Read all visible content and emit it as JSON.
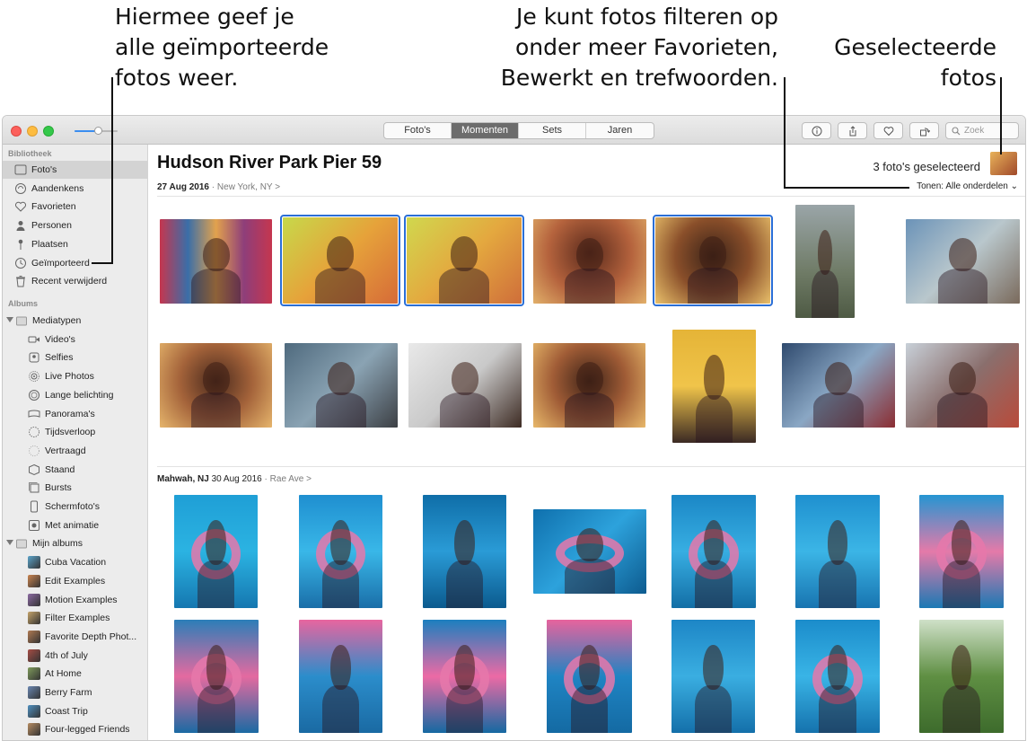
{
  "callouts": {
    "left": [
      "Hiermee geef je",
      "alle geïmporteerde",
      "fotos weer."
    ],
    "middle": [
      "Je kunt fotos filteren op",
      "onder meer Favorieten,",
      "Bewerkt en trefwoorden."
    ],
    "right": [
      "Geselecteerde",
      "fotos"
    ]
  },
  "toolbar": {
    "segments": [
      "Foto's",
      "Momenten",
      "Sets",
      "Jaren"
    ],
    "active_segment": "Momenten",
    "buttons": [
      "info-icon",
      "share-icon",
      "heart-icon",
      "rotate-icon"
    ],
    "search_placeholder": "Zoek"
  },
  "sidebar": {
    "library_header": "Bibliotheek",
    "library": [
      {
        "label": "Foto's",
        "icon": "photos-icon",
        "selected": true
      },
      {
        "label": "Aandenkens",
        "icon": "memories-icon"
      },
      {
        "label": "Favorieten",
        "icon": "heart-icon"
      },
      {
        "label": "Personen",
        "icon": "person-icon"
      },
      {
        "label": "Plaatsen",
        "icon": "pin-icon"
      },
      {
        "label": "Geïmporteerd",
        "icon": "clock-icon"
      },
      {
        "label": "Recent verwijderd",
        "icon": "trash-icon"
      }
    ],
    "albums_header": "Albums",
    "media_types_label": "Mediatypen",
    "media_types": [
      {
        "label": "Video's",
        "icon": "video-icon"
      },
      {
        "label": "Selfies",
        "icon": "selfie-icon"
      },
      {
        "label": "Live Photos",
        "icon": "live-icon"
      },
      {
        "label": "Lange belichting",
        "icon": "long-exposure-icon"
      },
      {
        "label": "Panorama's",
        "icon": "panorama-icon"
      },
      {
        "label": "Tijdsverloop",
        "icon": "timelapse-icon"
      },
      {
        "label": "Vertraagd",
        "icon": "slomo-icon"
      },
      {
        "label": "Staand",
        "icon": "portrait-icon"
      },
      {
        "label": "Bursts",
        "icon": "burst-icon"
      },
      {
        "label": "Schermfoto's",
        "icon": "screenshot-icon"
      },
      {
        "label": "Met animatie",
        "icon": "animated-icon"
      }
    ],
    "my_albums_label": "Mijn albums",
    "my_albums": [
      {
        "label": "Cuba Vacation"
      },
      {
        "label": "Edit Examples"
      },
      {
        "label": "Motion Examples"
      },
      {
        "label": "Filter Examples"
      },
      {
        "label": "Favorite Depth Phot..."
      },
      {
        "label": "4th of July"
      },
      {
        "label": "At Home"
      },
      {
        "label": "Berry Farm"
      },
      {
        "label": "Coast Trip"
      },
      {
        "label": "Four-legged Friends"
      }
    ]
  },
  "main": {
    "title": "Hudson River Park Pier 59",
    "date": "27 Aug 2016",
    "sep": "·",
    "location": "New York, NY",
    "chevron": ">",
    "selected_count": "3 foto's geselecteerd",
    "show_label": "Tonen:",
    "show_value": "Alle onderdelen",
    "section2_place": "Mahwah, NJ",
    "section2_date": "30 Aug 2016",
    "section2_street": "Rae Ave"
  },
  "colors": {
    "accent": "#2b6fd6",
    "active_segment": "#6c6c6c",
    "sidebar_bg": "#ececec"
  }
}
